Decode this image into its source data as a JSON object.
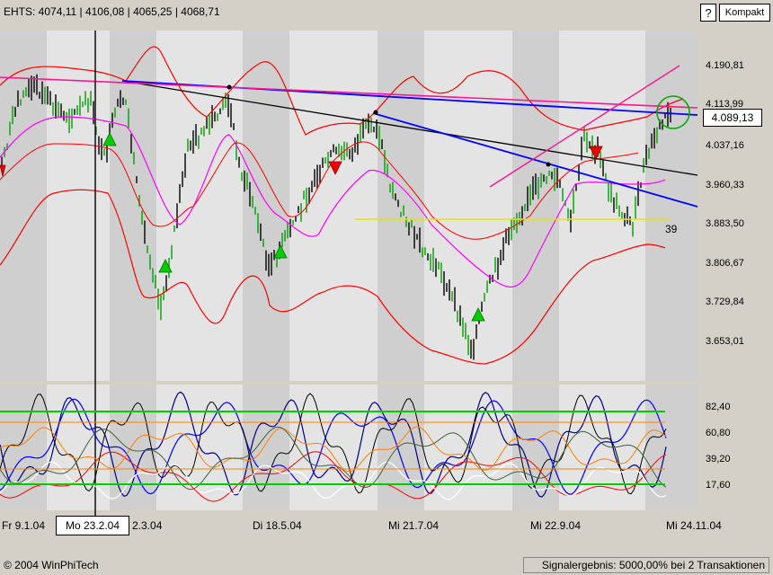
{
  "header": {
    "quote_text": "EHTS: 4074,11 | 4106,08 | 4065,25 | 4068,71",
    "help_label": "?",
    "kompakt_label": "Kompakt"
  },
  "price_axis": {
    "labels": [
      "4.190,81",
      "4.113,99",
      "4.037,16",
      "3.960,33",
      "3.883,50",
      "3.806,67",
      "3.729,84",
      "3.653,01"
    ],
    "current_price": "4.089,13"
  },
  "oscillator_axis": {
    "labels": [
      "82,40",
      "60,80",
      "39,20",
      "17,60"
    ]
  },
  "date_axis": {
    "labels": [
      "Fr 9.1.04",
      "2.3.04",
      "Di 18.5.04",
      "Mi 21.7.04",
      "Mi 22.9.04",
      "Mi 24.11.04"
    ],
    "cursor_date": "Mo 23.2.04"
  },
  "annotation": {
    "count_label": "39"
  },
  "footer": {
    "copyright": "© 2004 WinPhiTech",
    "signal_result": "Signalergebnis: 5000,00% bei 2 Transaktionen"
  },
  "colors": {
    "bollinger": "#ff0000",
    "moving_average": "#ff00ff",
    "trend_blue": "#0000ff",
    "trend_black": "#000000",
    "channel_pink": "#ff1493",
    "support_yellow": "#ffff00",
    "buy_signal": "#00cc00",
    "sell_signal": "#ff0000",
    "osc_bands": "#00cc00"
  }
}
